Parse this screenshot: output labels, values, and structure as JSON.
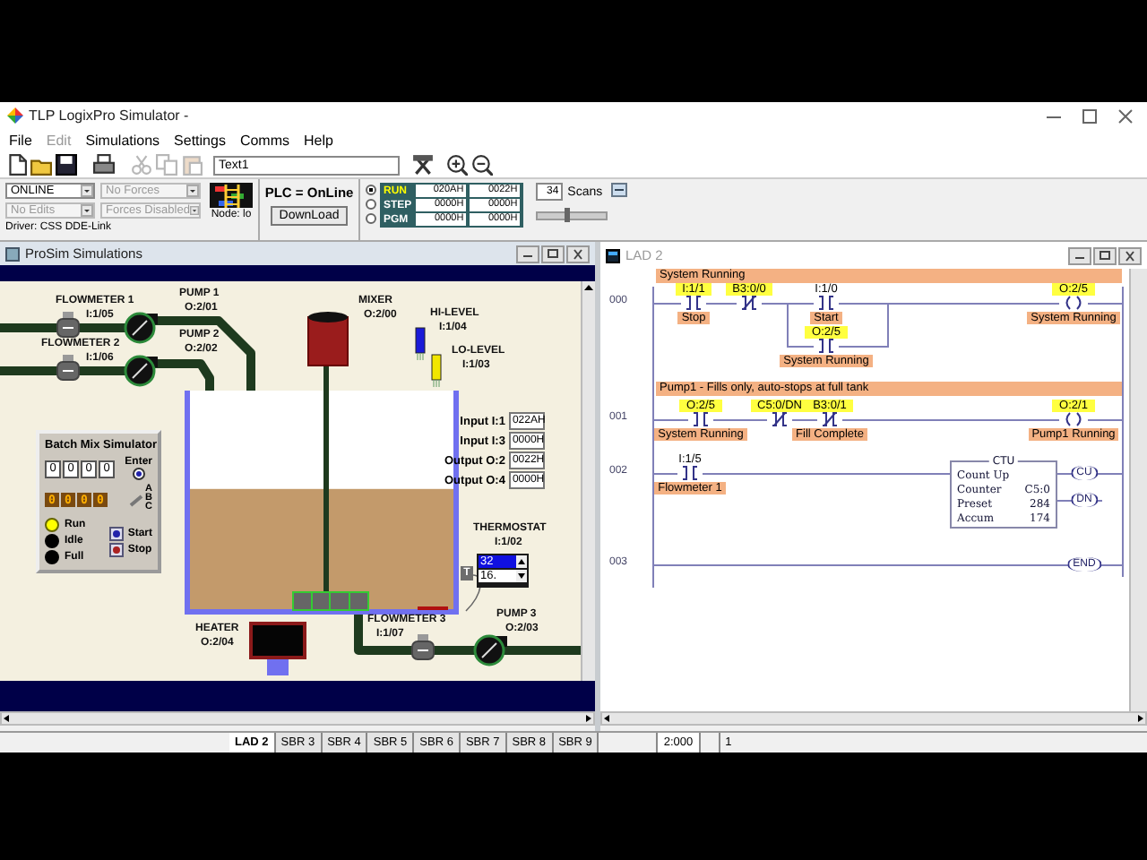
{
  "window": {
    "title": "TLP LogixPro Simulator  -"
  },
  "menu": [
    {
      "label": "File",
      "disabled": false
    },
    {
      "label": "Edit",
      "disabled": true
    },
    {
      "label": "Simulations",
      "disabled": false
    },
    {
      "label": "Settings",
      "disabled": false
    },
    {
      "label": "Comms",
      "disabled": false
    },
    {
      "label": "Help",
      "disabled": false
    }
  ],
  "toolbar": {
    "tools": [
      {
        "kind": "new",
        "disabled": false
      },
      {
        "kind": "open",
        "disabled": false
      },
      {
        "kind": "save",
        "disabled": false
      },
      {
        "kind": "print",
        "disabled": false
      },
      {
        "kind": "cut",
        "disabled": true
      },
      {
        "kind": "copy",
        "disabled": true
      },
      {
        "kind": "paste",
        "disabled": true
      },
      {
        "kind": "name-field",
        "value": "Text1"
      },
      {
        "kind": "tool",
        "disabled": false
      },
      {
        "kind": "zoom-in",
        "disabled": false
      },
      {
        "kind": "zoom-out",
        "disabled": false
      }
    ]
  },
  "plc_panel": {
    "mode_select": {
      "value": "ONLINE",
      "disabled": false
    },
    "forces_select": {
      "value": "No Forces",
      "disabled": true
    },
    "edits_select": {
      "value": "No Edits",
      "disabled": true
    },
    "forces_state_select": {
      "value": "Forces Disabled",
      "disabled": true
    },
    "node": "Node: lo",
    "driver": "Driver: CSS DDE-Link",
    "status": "PLC = OnLine",
    "download_button": "DownLoad",
    "modes": [
      {
        "label": "RUN",
        "selected": true
      },
      {
        "label": "STEP",
        "selected": false
      },
      {
        "label": "PGM",
        "selected": false
      }
    ],
    "registers": [
      [
        "020AH",
        "0022H"
      ],
      [
        "0000H",
        "0000H"
      ],
      [
        "0000H",
        "0000H"
      ]
    ],
    "scans": {
      "value": "34",
      "label": "Scans",
      "level": 0.45
    }
  },
  "prosim": {
    "title": "ProSim Simulations",
    "devices": [
      {
        "kind": "flowmeter",
        "name": "FLOWMETER 1",
        "address": "I:1/05"
      },
      {
        "kind": "flowmeter",
        "name": "FLOWMETER 2",
        "address": "I:1/06"
      },
      {
        "kind": "pump",
        "name": "PUMP 1",
        "address": "O:2/01"
      },
      {
        "kind": "pump",
        "name": "PUMP 2",
        "address": "O:2/02"
      },
      {
        "kind": "mixer",
        "name": "MIXER",
        "address": "O:2/00"
      },
      {
        "kind": "level_sensor",
        "name": "HI-LEVEL",
        "address": "I:1/04",
        "active": false
      },
      {
        "kind": "level_sensor",
        "name": "LO-LEVEL",
        "address": "I:1/03",
        "active": true
      },
      {
        "kind": "thermostat",
        "name": "THERMOSTAT",
        "address": "I:1/02"
      },
      {
        "kind": "heater",
        "name": "HEATER",
        "address": "O:2/04"
      },
      {
        "kind": "flowmeter",
        "name": "FLOWMETER 3",
        "address": "I:1/07"
      },
      {
        "kind": "pump",
        "name": "PUMP 3",
        "address": "O:2/03"
      }
    ],
    "tank": {
      "level": 0.55
    },
    "io_registers": [
      {
        "label": "Input I:1",
        "value": "022AH"
      },
      {
        "label": "Input I:3",
        "value": "0000H"
      },
      {
        "label": "Output O:2",
        "value": "0022H"
      },
      {
        "label": "Output O:4",
        "value": "0000H"
      }
    ],
    "thermostat_control": {
      "setpoint": "32",
      "reading": "16.",
      "sensor_label": "T"
    },
    "batch_panel": {
      "title": "Batch Mix Simulator",
      "thumbwheels": [
        "0",
        "0",
        "0",
        "0"
      ],
      "display": [
        "0",
        "0",
        "0",
        "0"
      ],
      "enter": "Enter",
      "enter_selected": true,
      "switch_labels": [
        "A",
        "B",
        "C"
      ],
      "lamps": [
        {
          "label": "Run",
          "on": true
        },
        {
          "label": "Idle",
          "on": false
        },
        {
          "label": "Full",
          "on": false
        }
      ],
      "buttons": [
        "Start",
        "Stop"
      ]
    }
  },
  "ladder": {
    "title": "LAD 2",
    "rungs": [
      {
        "number": "000",
        "comment": "System Running",
        "elements": [
          {
            "kind": "xic",
            "address": "I:1/1",
            "label": "Stop",
            "highlighted": true
          },
          {
            "kind": "xio",
            "address": "B3:0/0",
            "highlighted": true
          },
          {
            "kind": "xic",
            "address": "I:1/0",
            "label": "Start",
            "highlighted": false
          },
          {
            "kind": "xic",
            "address": "O:2/5",
            "label": "System Running",
            "highlighted": true
          },
          {
            "kind": "ote",
            "address": "O:2/5",
            "label": "System Running",
            "highlighted": true
          }
        ]
      },
      {
        "number": "001",
        "comment": "Pump1 - Fills only, auto-stops at full tank",
        "elements": [
          {
            "kind": "xic",
            "address": "O:2/5",
            "label": "System Running",
            "highlighted": true
          },
          {
            "kind": "xio",
            "address": "C5:0/DN",
            "highlighted": true
          },
          {
            "kind": "xio",
            "address": "B3:0/1",
            "label": "Fill Complete",
            "highlighted": true
          },
          {
            "kind": "ote",
            "address": "O:2/1",
            "label": "Pump1 Running",
            "highlighted": true
          }
        ]
      },
      {
        "number": "002",
        "elements": [
          {
            "kind": "xic",
            "address": "I:1/5",
            "label": "Flowmeter 1",
            "highlighted": false
          },
          {
            "kind": "ctu",
            "title": "CTU",
            "fields": [
              {
                "name": "Count Up"
              },
              {
                "name": "Counter",
                "value": "C5:0"
              },
              {
                "name": "Preset",
                "value": "284"
              },
              {
                "name": "Accum",
                "value": "174"
              }
            ],
            "outputs": [
              "CU",
              "DN"
            ]
          }
        ]
      },
      {
        "number": "003",
        "elements": [
          {
            "kind": "end",
            "label": "END"
          }
        ]
      }
    ]
  },
  "status_bar": {
    "tabs": [
      {
        "label": "LAD 2",
        "selected": true
      },
      {
        "label": "SBR 3",
        "selected": false
      },
      {
        "label": "SBR 4",
        "selected": false
      },
      {
        "label": "SBR 5",
        "selected": false
      },
      {
        "label": "SBR 6",
        "selected": false
      },
      {
        "label": "SBR 7",
        "selected": false
      },
      {
        "label": "SBR 8",
        "selected": false
      },
      {
        "label": "SBR 9",
        "selected": false
      }
    ],
    "position": "2:000",
    "ladder_status": "1"
  }
}
